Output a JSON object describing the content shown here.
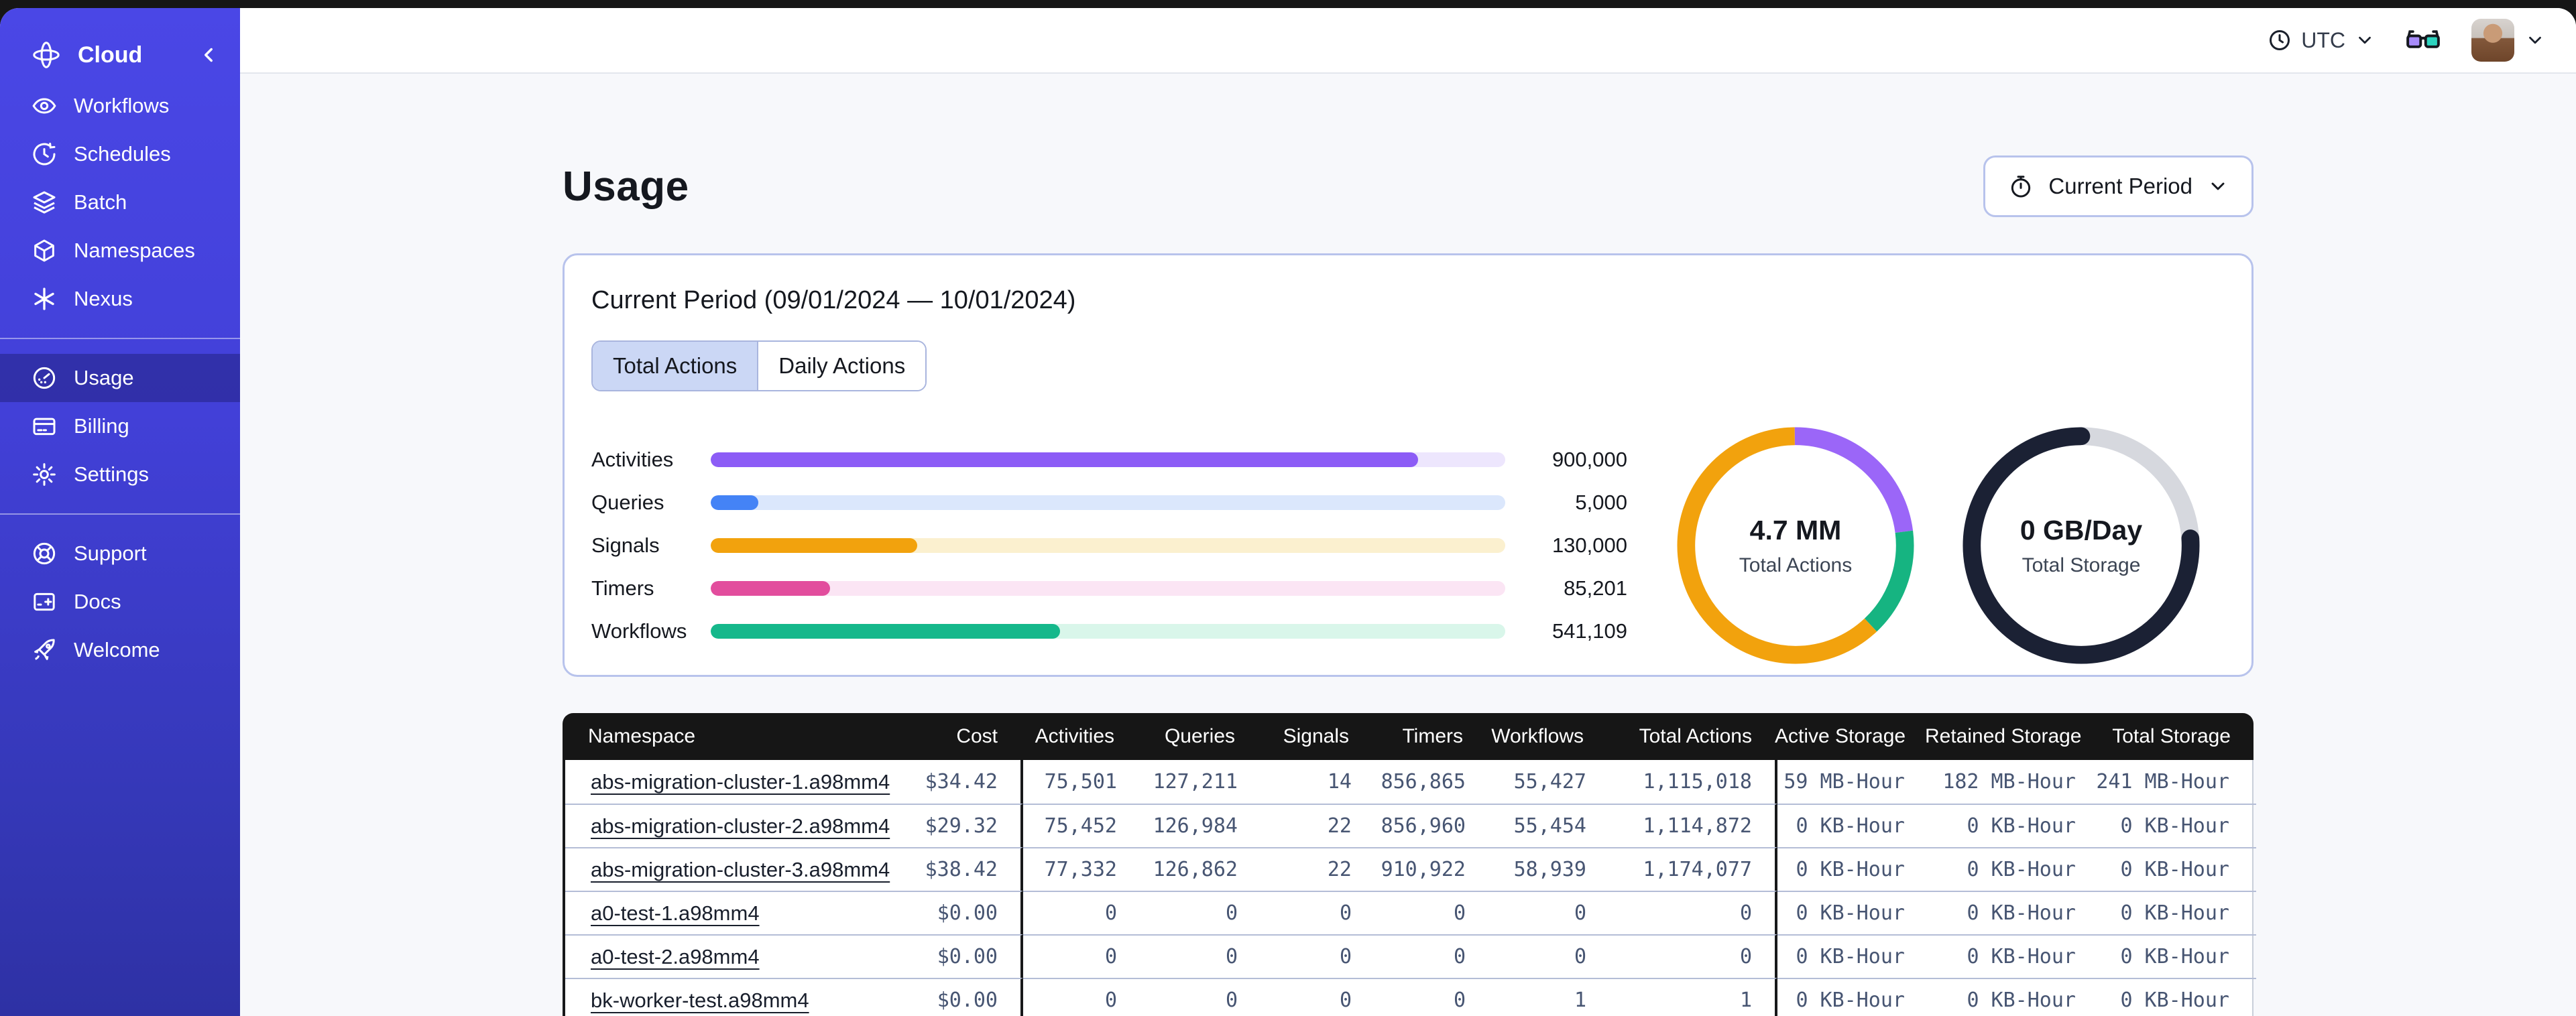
{
  "sidebar": {
    "header": {
      "label": "Cloud",
      "icon": "cloud-orbit-icon",
      "collapse_icon": "chevron-left-icon"
    },
    "groups": [
      {
        "items": [
          {
            "label": "Workflows",
            "icon": "workflows-icon",
            "active": false
          },
          {
            "label": "Schedules",
            "icon": "schedules-icon",
            "active": false
          },
          {
            "label": "Batch",
            "icon": "batch-icon",
            "active": false
          },
          {
            "label": "Namespaces",
            "icon": "namespaces-icon",
            "active": false
          },
          {
            "label": "Nexus",
            "icon": "nexus-icon",
            "active": false
          }
        ]
      },
      {
        "items": [
          {
            "label": "Usage",
            "icon": "usage-icon",
            "active": true
          },
          {
            "label": "Billing",
            "icon": "billing-icon",
            "active": false
          },
          {
            "label": "Settings",
            "icon": "settings-icon",
            "active": false
          }
        ]
      },
      {
        "items": [
          {
            "label": "Support",
            "icon": "support-icon",
            "active": false
          },
          {
            "label": "Docs",
            "icon": "docs-icon",
            "active": false
          },
          {
            "label": "Welcome",
            "icon": "welcome-icon",
            "active": false
          }
        ]
      }
    ]
  },
  "topbar": {
    "timezone": {
      "label": "UTC",
      "icon": "clock-icon",
      "chevron": "chevron-down-icon"
    },
    "labs": {
      "icon": "glasses-icon",
      "lens_left_color": "#A78BFA",
      "lens_right_color": "#2DD4BF"
    },
    "account": {
      "avatar": "user-avatar",
      "chevron": "chevron-down-icon"
    }
  },
  "page": {
    "title": "Usage",
    "period_button": {
      "label": "Current Period",
      "icon": "stopwatch-icon",
      "chevron": "chevron-down-icon"
    }
  },
  "usage_card": {
    "title": "Current Period (09/01/2024 — 10/01/2024)",
    "tabs": [
      {
        "label": "Total Actions",
        "active": true
      },
      {
        "label": "Daily Actions",
        "active": false
      }
    ],
    "chart_data": {
      "type": "bar",
      "orientation": "horizontal",
      "bars": [
        {
          "label": "Activities",
          "value": 900000,
          "value_label": "900,000",
          "fill_pct": 89,
          "color": "#8C5CF6",
          "track_color": "#EDE6FD"
        },
        {
          "label": "Queries",
          "value": 5000,
          "value_label": "5,000",
          "fill_pct": 6,
          "color": "#4483F6",
          "track_color": "#DBE7FC"
        },
        {
          "label": "Signals",
          "value": 130000,
          "value_label": "130,000",
          "fill_pct": 26,
          "color": "#F2A20D",
          "track_color": "#FBF0CF"
        },
        {
          "label": "Timers",
          "value": 85201,
          "value_label": "85,201",
          "fill_pct": 15,
          "color": "#E24D9D",
          "track_color": "#FBE5F4"
        },
        {
          "label": "Workflows",
          "value": 541109,
          "value_label": "541,109",
          "fill_pct": 44,
          "color": "#15B88B",
          "track_color": "#D9F6EA"
        }
      ],
      "donuts": [
        {
          "type": "pie",
          "center_value": "4.7 MM",
          "label": "Total Actions",
          "linecap": "butt",
          "segments": [
            {
              "name": "activities",
              "pct": 23,
              "color": "#9B66F8"
            },
            {
              "name": "workflows",
              "pct": 15,
              "color": "#16B481"
            },
            {
              "name": "other-actions",
              "pct": 62,
              "color": "#F2A20D"
            }
          ]
        },
        {
          "type": "pie",
          "center_value": "0 GB/Day",
          "label": "Total Storage",
          "linecap": "round",
          "segments": [
            {
              "name": "remaining",
              "pct": 24,
              "color": "#D6D8DE"
            },
            {
              "name": "used",
              "pct": 76,
              "color": "#1B2134"
            }
          ]
        }
      ]
    }
  },
  "table": {
    "columns": [
      {
        "label": "Namespace"
      },
      {
        "label": "Cost"
      },
      {
        "label": "Activities"
      },
      {
        "label": "Queries"
      },
      {
        "label": "Signals"
      },
      {
        "label": "Timers"
      },
      {
        "label": "Workflows"
      },
      {
        "label": "Total Actions"
      },
      {
        "label": "Active Storage"
      },
      {
        "label": "Retained Storage"
      },
      {
        "label": "Total Storage"
      }
    ],
    "rows": [
      {
        "namespace": "abs-migration-cluster-1.a98mm4",
        "cost": "$34.42",
        "activities": "75,501",
        "queries": "127,211",
        "signals": "14",
        "timers": "856,865",
        "workflows": "55,427",
        "total_actions": "1,115,018",
        "active_storage": "59 MB-Hour",
        "retained_storage": "182 MB-Hour",
        "total_storage": "241 MB-Hour"
      },
      {
        "namespace": "abs-migration-cluster-2.a98mm4",
        "cost": "$29.32",
        "activities": "75,452",
        "queries": "126,984",
        "signals": "22",
        "timers": "856,960",
        "workflows": "55,454",
        "total_actions": "1,114,872",
        "active_storage": "0 KB-Hour",
        "retained_storage": "0 KB-Hour",
        "total_storage": "0 KB-Hour"
      },
      {
        "namespace": "abs-migration-cluster-3.a98mm4",
        "cost": "$38.42",
        "activities": "77,332",
        "queries": "126,862",
        "signals": "22",
        "timers": "910,922",
        "workflows": "58,939",
        "total_actions": "1,174,077",
        "active_storage": "0 KB-Hour",
        "retained_storage": "0 KB-Hour",
        "total_storage": "0 KB-Hour"
      },
      {
        "namespace": "a0-test-1.a98mm4",
        "cost": "$0.00",
        "activities": "0",
        "queries": "0",
        "signals": "0",
        "timers": "0",
        "workflows": "0",
        "total_actions": "0",
        "active_storage": "0 KB-Hour",
        "retained_storage": "0 KB-Hour",
        "total_storage": "0 KB-Hour"
      },
      {
        "namespace": "a0-test-2.a98mm4",
        "cost": "$0.00",
        "activities": "0",
        "queries": "0",
        "signals": "0",
        "timers": "0",
        "workflows": "0",
        "total_actions": "0",
        "active_storage": "0 KB-Hour",
        "retained_storage": "0 KB-Hour",
        "total_storage": "0 KB-Hour"
      },
      {
        "namespace": "bk-worker-test.a98mm4",
        "cost": "$0.00",
        "activities": "0",
        "queries": "0",
        "signals": "0",
        "timers": "0",
        "workflows": "1",
        "total_actions": "1",
        "active_storage": "0 KB-Hour",
        "retained_storage": "0 KB-Hour",
        "total_storage": "0 KB-Hour"
      }
    ]
  }
}
